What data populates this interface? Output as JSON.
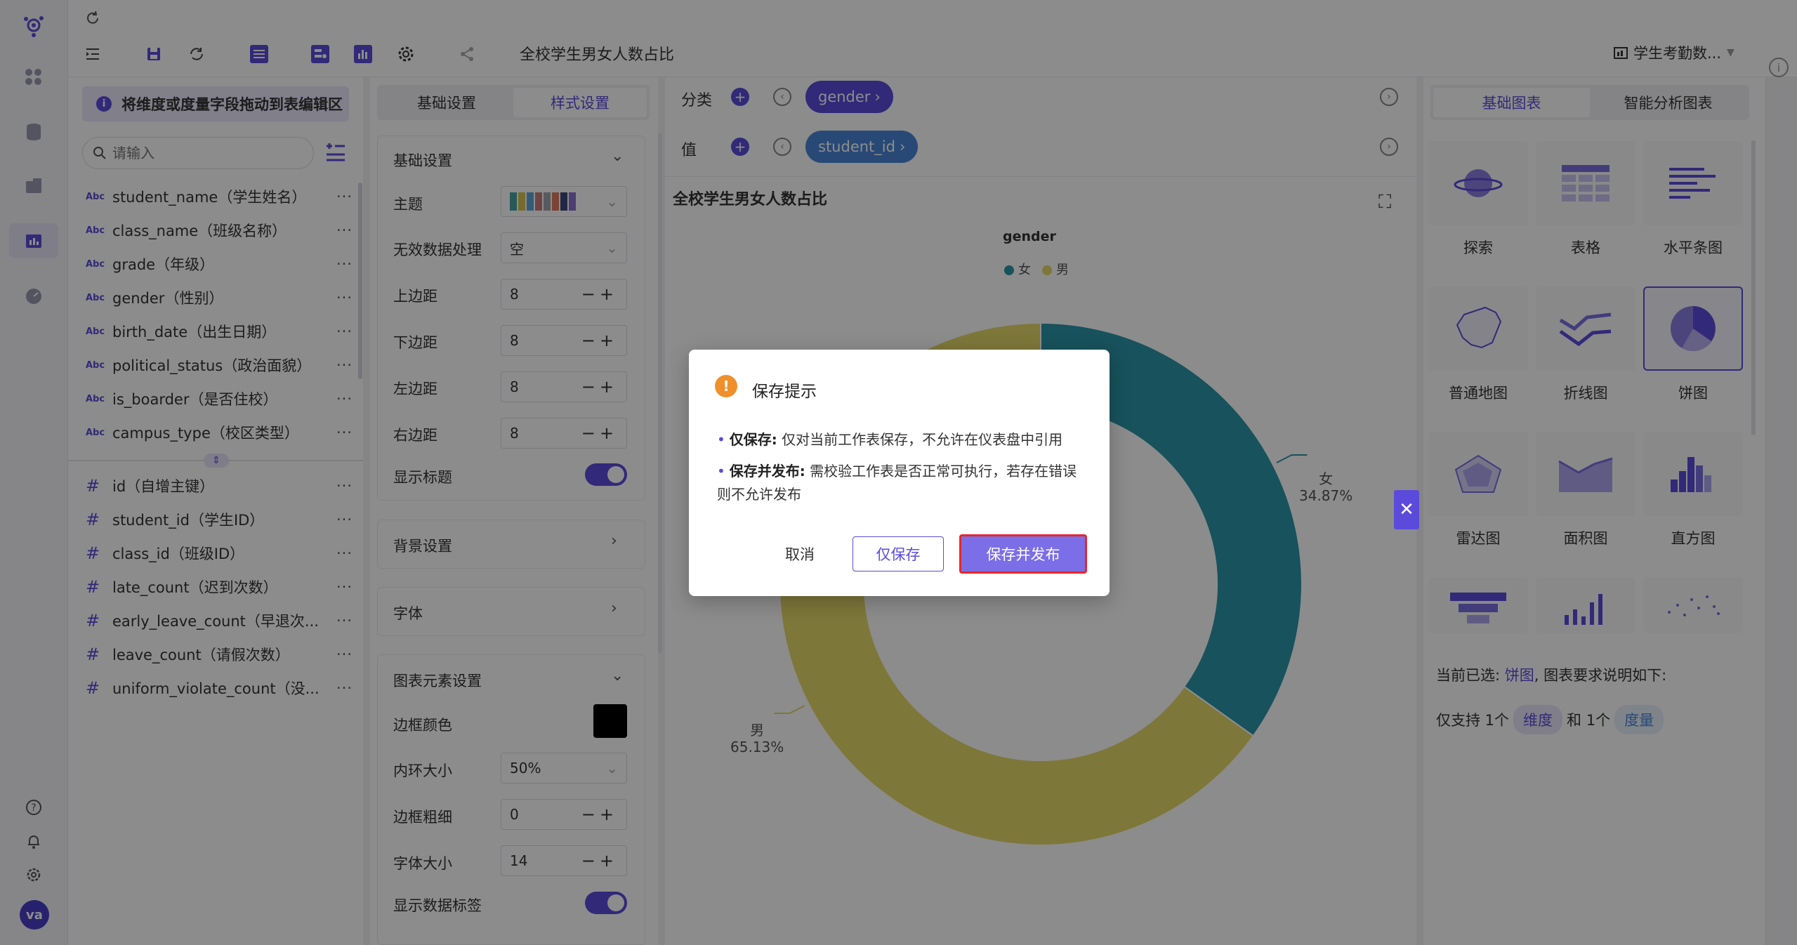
{
  "topbar": {
    "title": "全校学生男女人数占比",
    "dataset": "学生考勤数..."
  },
  "fields_panel": {
    "hint": "将维度或度量字段拖动到表编辑区",
    "search_placeholder": "请输入",
    "dimensions": [
      {
        "type": "Abc",
        "name": "student_name（学生姓名）"
      },
      {
        "type": "Abc",
        "name": "class_name（班级名称）"
      },
      {
        "type": "Abc",
        "name": "grade（年级）"
      },
      {
        "type": "Abc",
        "name": "gender（性别）"
      },
      {
        "type": "Abc",
        "name": "birth_date（出生日期）"
      },
      {
        "type": "Abc",
        "name": "political_status（政治面貌）"
      },
      {
        "type": "Abc",
        "name": "is_boarder（是否住校）"
      },
      {
        "type": "Abc",
        "name": "campus_type（校区类型）"
      }
    ],
    "measures": [
      {
        "type": "#",
        "name": "id（自增主键）"
      },
      {
        "type": "#",
        "name": "student_id（学生ID）"
      },
      {
        "type": "#",
        "name": "class_id（班级ID）"
      },
      {
        "type": "#",
        "name": "late_count（迟到次数）"
      },
      {
        "type": "#",
        "name": "early_leave_count（早退次..."
      },
      {
        "type": "#",
        "name": "leave_count（请假次数）"
      },
      {
        "type": "#",
        "name": "uniform_violate_count（没..."
      }
    ],
    "more": "···"
  },
  "settings_panel": {
    "tabs": [
      "基础设置",
      "样式设置"
    ],
    "basic_section": "基础设置",
    "theme_label": "主题",
    "invalid_label": "无效数据处理",
    "invalid_value": "空",
    "margin_top_label": "上边距",
    "margin_top": "8",
    "margin_bottom_label": "下边距",
    "margin_bottom": "8",
    "margin_left_label": "左边距",
    "margin_left": "8",
    "margin_right_label": "右边距",
    "margin_right": "8",
    "show_title_label": "显示标题",
    "bg_section": "背景设置",
    "font_section": "字体",
    "elements_section": "图表元素设置",
    "border_color_label": "边框颜色",
    "inner_radius_label": "内环大小",
    "inner_radius": "50%",
    "border_width_label": "边框粗细",
    "border_width": "0",
    "font_size_label": "字体大小",
    "font_size": "14",
    "show_data_label": "显示数据标签",
    "pm": "−+"
  },
  "shelves": {
    "category_label": "分类",
    "category_pill": "gender",
    "value_label": "值",
    "value_pill": "student_id"
  },
  "chart_data": {
    "type": "pie",
    "title": "全校学生男女人数占比",
    "legend_title": "gender",
    "categories": [
      "女",
      "男"
    ],
    "values": [
      34.87,
      65.13
    ],
    "value_labels": [
      "34.87%",
      "65.13%"
    ],
    "colors": [
      "#2c96a8",
      "#e5d96a"
    ],
    "inner_radius": 0.5,
    "legend_position": "top-center"
  },
  "chart_types": {
    "tabs": [
      "基础图表",
      "智能分析图表"
    ],
    "items": [
      "探索",
      "表格",
      "水平条图",
      "普通地图",
      "折线图",
      "饼图",
      "雷达图",
      "面积图",
      "直方图"
    ],
    "selected": "饼图",
    "current_prefix": "当前已选:",
    "current_value": "饼图",
    "current_suffix": ", 图表要求说明如下:",
    "req_prefix": "仅支持 1个",
    "req_dim": "维度",
    "req_mid": "和 1个",
    "req_measure": "度量"
  },
  "dialog": {
    "title": "保存提示",
    "line1_bold": "仅保存:",
    "line1_text": "仅对当前工作表保存，不允许在仪表盘中引用",
    "line2_bold": "保存并发布:",
    "line2_text": "需校验工作表是否正常可执行，若存在错误则不允许发布",
    "cancel": "取消",
    "save_only": "仅保存",
    "save_publish": "保存并发布"
  },
  "user": {
    "avatar": "va"
  },
  "colors": {
    "accent": "#5b4bdb",
    "highlight": "#e8262a"
  }
}
